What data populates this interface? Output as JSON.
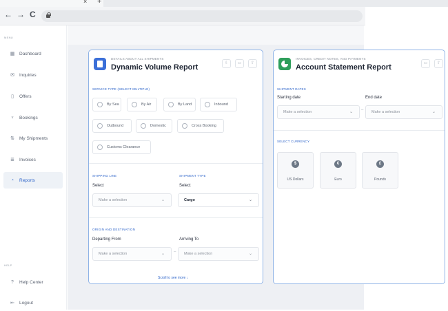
{
  "browser": {
    "tab_close": "×",
    "tab_new": "+",
    "back": "←",
    "forward": "→",
    "reload": "C"
  },
  "sidebar": {
    "menu_label": "MENU",
    "help_label": "HELP",
    "items": [
      {
        "label": "Dashboard",
        "icon": "dashboard-icon",
        "glyph": "▦"
      },
      {
        "label": "Inquiries",
        "icon": "inquiries-icon",
        "glyph": "✉"
      },
      {
        "label": "Offers",
        "icon": "offers-icon",
        "glyph": "▯"
      },
      {
        "label": "Bookings",
        "icon": "bookings-icon",
        "glyph": "♆"
      },
      {
        "label": "My Shipments",
        "icon": "shipments-icon",
        "glyph": "⇅"
      },
      {
        "label": "Invoices",
        "icon": "invoices-icon",
        "glyph": "≣"
      },
      {
        "label": "Reports",
        "icon": "reports-icon",
        "glyph": "◔",
        "active": true
      }
    ],
    "help_items": [
      {
        "label": "Help Center",
        "icon": "help-icon",
        "glyph": "?"
      },
      {
        "label": "Logout",
        "icon": "logout-icon",
        "glyph": "⇤"
      }
    ]
  },
  "volume_report": {
    "subtitle": "DETAILS ABOUT ALL SHIPMENTS",
    "title": "Dynamic Volume Report",
    "service_type_label": "SERVICE TYPE (SELECT MULTIPLE)",
    "service_types": [
      "By Sea",
      "By Air",
      "By Land",
      "Inbound",
      "Outbound",
      "Domestic",
      "Cross Booking",
      "Customs Clearance"
    ],
    "shipping_line": {
      "section": "SHIPPING LINE",
      "label": "Select",
      "placeholder": "Make a selection"
    },
    "shipment_type": {
      "section": "SHIPMENT TYPE",
      "label": "Select",
      "value": "Cargo"
    },
    "origin_section": "ORIGIN AND DESTINATION",
    "departing": {
      "label": "Departing From",
      "placeholder": "Make a selection"
    },
    "arriving": {
      "label": "Arriving To",
      "placeholder": "Make a selection"
    },
    "scroll_more": "Scroll to see more  ↓"
  },
  "statement_report": {
    "subtitle": "INVOICES, CREDIT NOTES, AND PAYMENTS",
    "title": "Account Statement Report",
    "dates_section": "SHIPMENT DATES",
    "start": {
      "label": "Starting date",
      "placeholder": "Make a selection"
    },
    "end": {
      "label": "End date",
      "placeholder": "Make a selection"
    },
    "currency_section": "SELECT CURRENCY",
    "currencies": [
      "US Dollars",
      "Euro",
      "Pounds"
    ]
  },
  "colors": {
    "accent": "#2c63c9",
    "card_border": "#8fb3e6",
    "volume_icon_bg": "#3b6fd8",
    "statement_icon_bg": "#2e9e5b"
  }
}
